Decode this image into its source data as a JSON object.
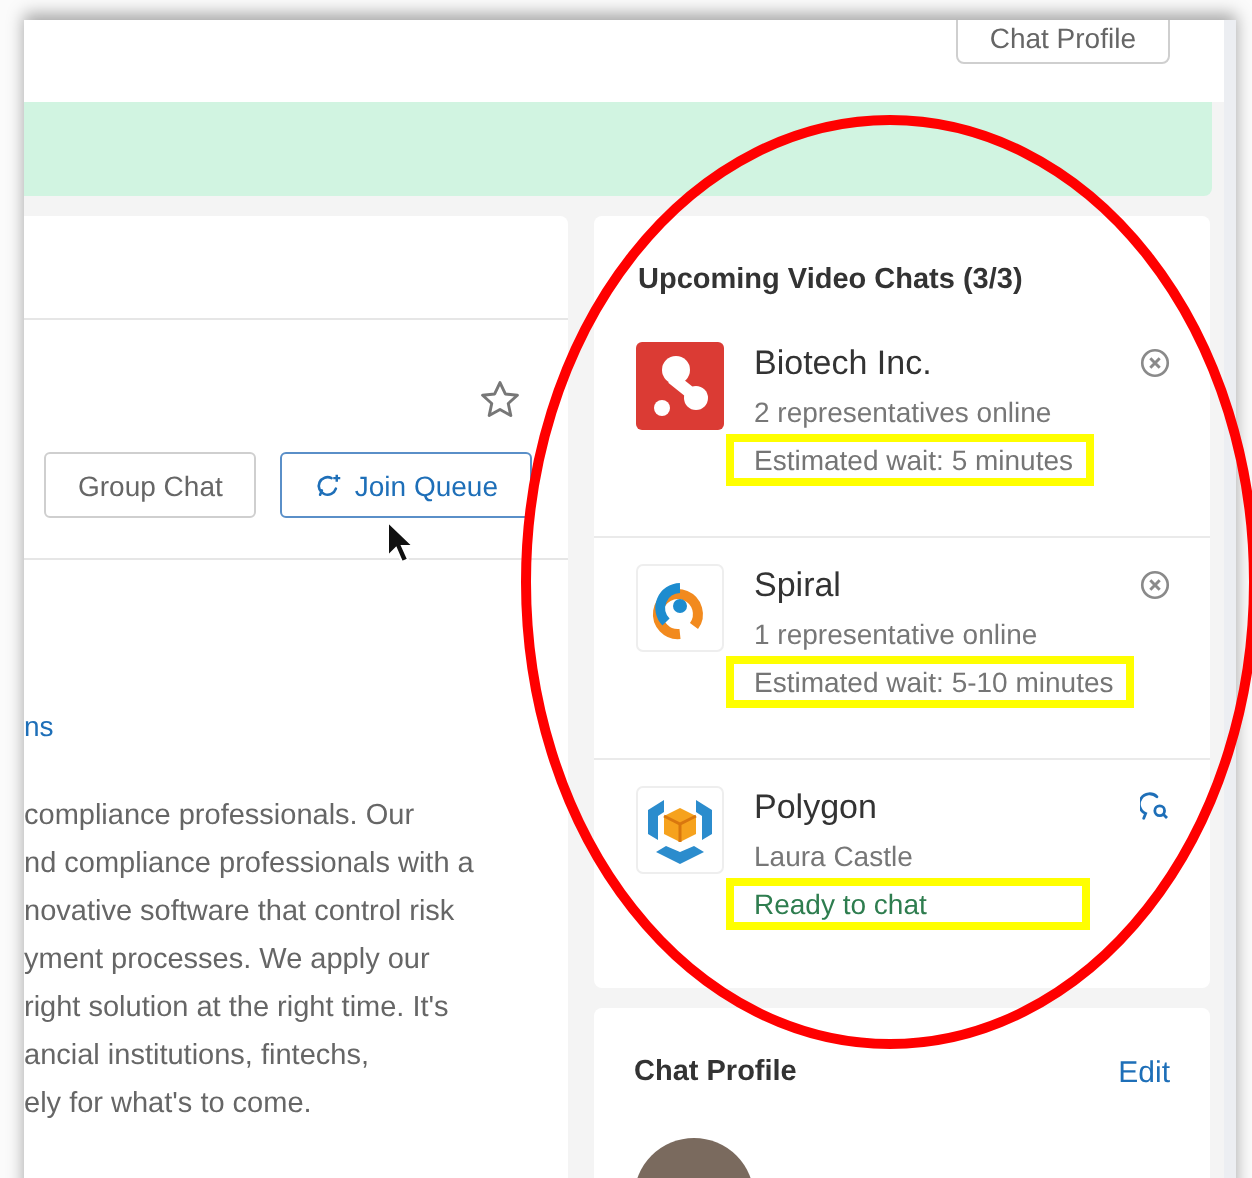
{
  "top_bar": {
    "profile_button": "Chat Profile"
  },
  "company_card": {
    "favorite": false,
    "buttons": [
      {
        "label": "Group Chat",
        "kind": "plain"
      },
      {
        "label": "Join Queue",
        "kind": "primary"
      }
    ],
    "link": "ns",
    "description_lines": [
      "compliance professionals. Our",
      "nd compliance professionals with a",
      "novative software that control risk",
      "yment processes. We apply our",
      "right solution at the right time. It's",
      "ancial institutions, fintechs,",
      "ely for what's to come."
    ]
  },
  "upcoming_chats": {
    "title": "Upcoming Video Chats (3/3)",
    "items": [
      {
        "name": "Biotech Inc.",
        "detail": "2 representatives online",
        "status": "Estimated wait: 5 minutes",
        "kind": "waiting",
        "highlighted": true
      },
      {
        "name": "Spiral",
        "detail": "1 representative online",
        "status": "Estimated wait: 5-10 minutes",
        "kind": "waiting",
        "highlighted": true
      },
      {
        "name": "Polygon",
        "detail": "Laura Castle",
        "status": "Ready to chat",
        "kind": "ready",
        "highlighted": true
      }
    ]
  },
  "chat_profile": {
    "title": "Chat Profile",
    "edit": "Edit"
  }
}
